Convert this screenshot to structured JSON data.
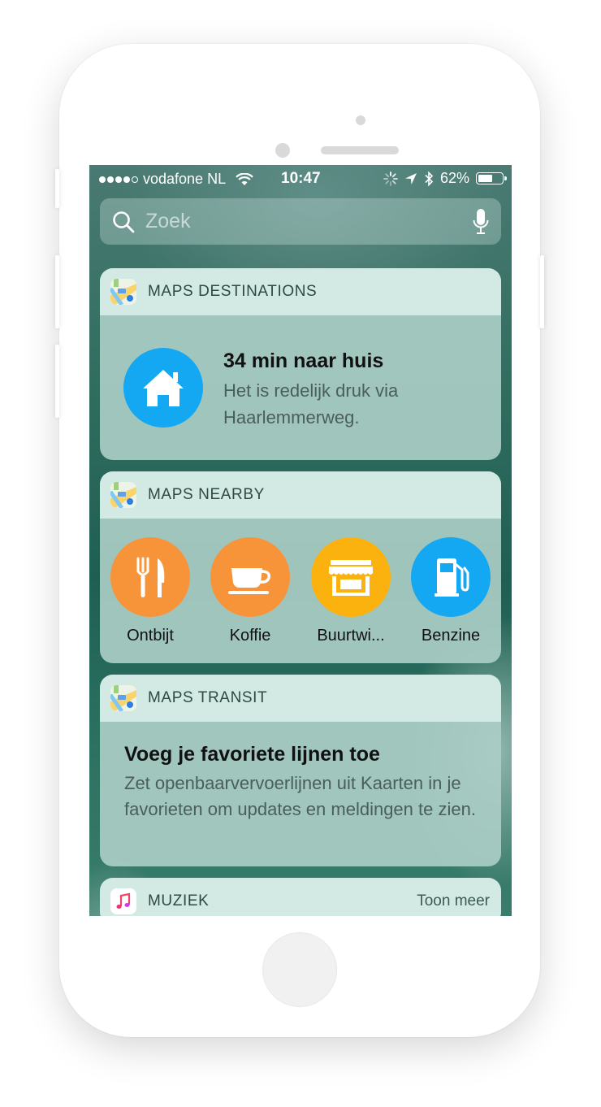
{
  "status_bar": {
    "carrier": "vodafone NL",
    "time": "10:47",
    "battery_percent": "62%",
    "battery_level": 0.62
  },
  "search": {
    "placeholder": "Zoek"
  },
  "widgets": {
    "destinations": {
      "title": "MAPS DESTINATIONS",
      "headline": "34 min naar huis",
      "subtitle": "Het is redelijk druk via Haarlemmerweg."
    },
    "nearby": {
      "title": "MAPS NEARBY",
      "items": [
        {
          "label": "Ontbijt",
          "icon": "fork-knife-icon",
          "color": "#f7943a"
        },
        {
          "label": "Koffie",
          "icon": "coffee-cup-icon",
          "color": "#f7943a"
        },
        {
          "label": "Buurtwi...",
          "icon": "store-icon",
          "color": "#fbb20f"
        },
        {
          "label": "Benzine",
          "icon": "fuel-pump-icon",
          "color": "#14a8f2"
        }
      ]
    },
    "transit": {
      "title": "MAPS TRANSIT",
      "headline": "Voeg je favoriete lijnen toe",
      "subtitle": "Zet openbaarvervoerlijnen uit Kaarten in je favorieten om updates en meldingen te zien."
    },
    "music": {
      "title": "MUZIEK",
      "more_label": "Toon meer"
    }
  },
  "colors": {
    "home_circle": "#14a8f2",
    "orange": "#f7943a",
    "yellow": "#fbb20f",
    "blue": "#14a8f2"
  }
}
